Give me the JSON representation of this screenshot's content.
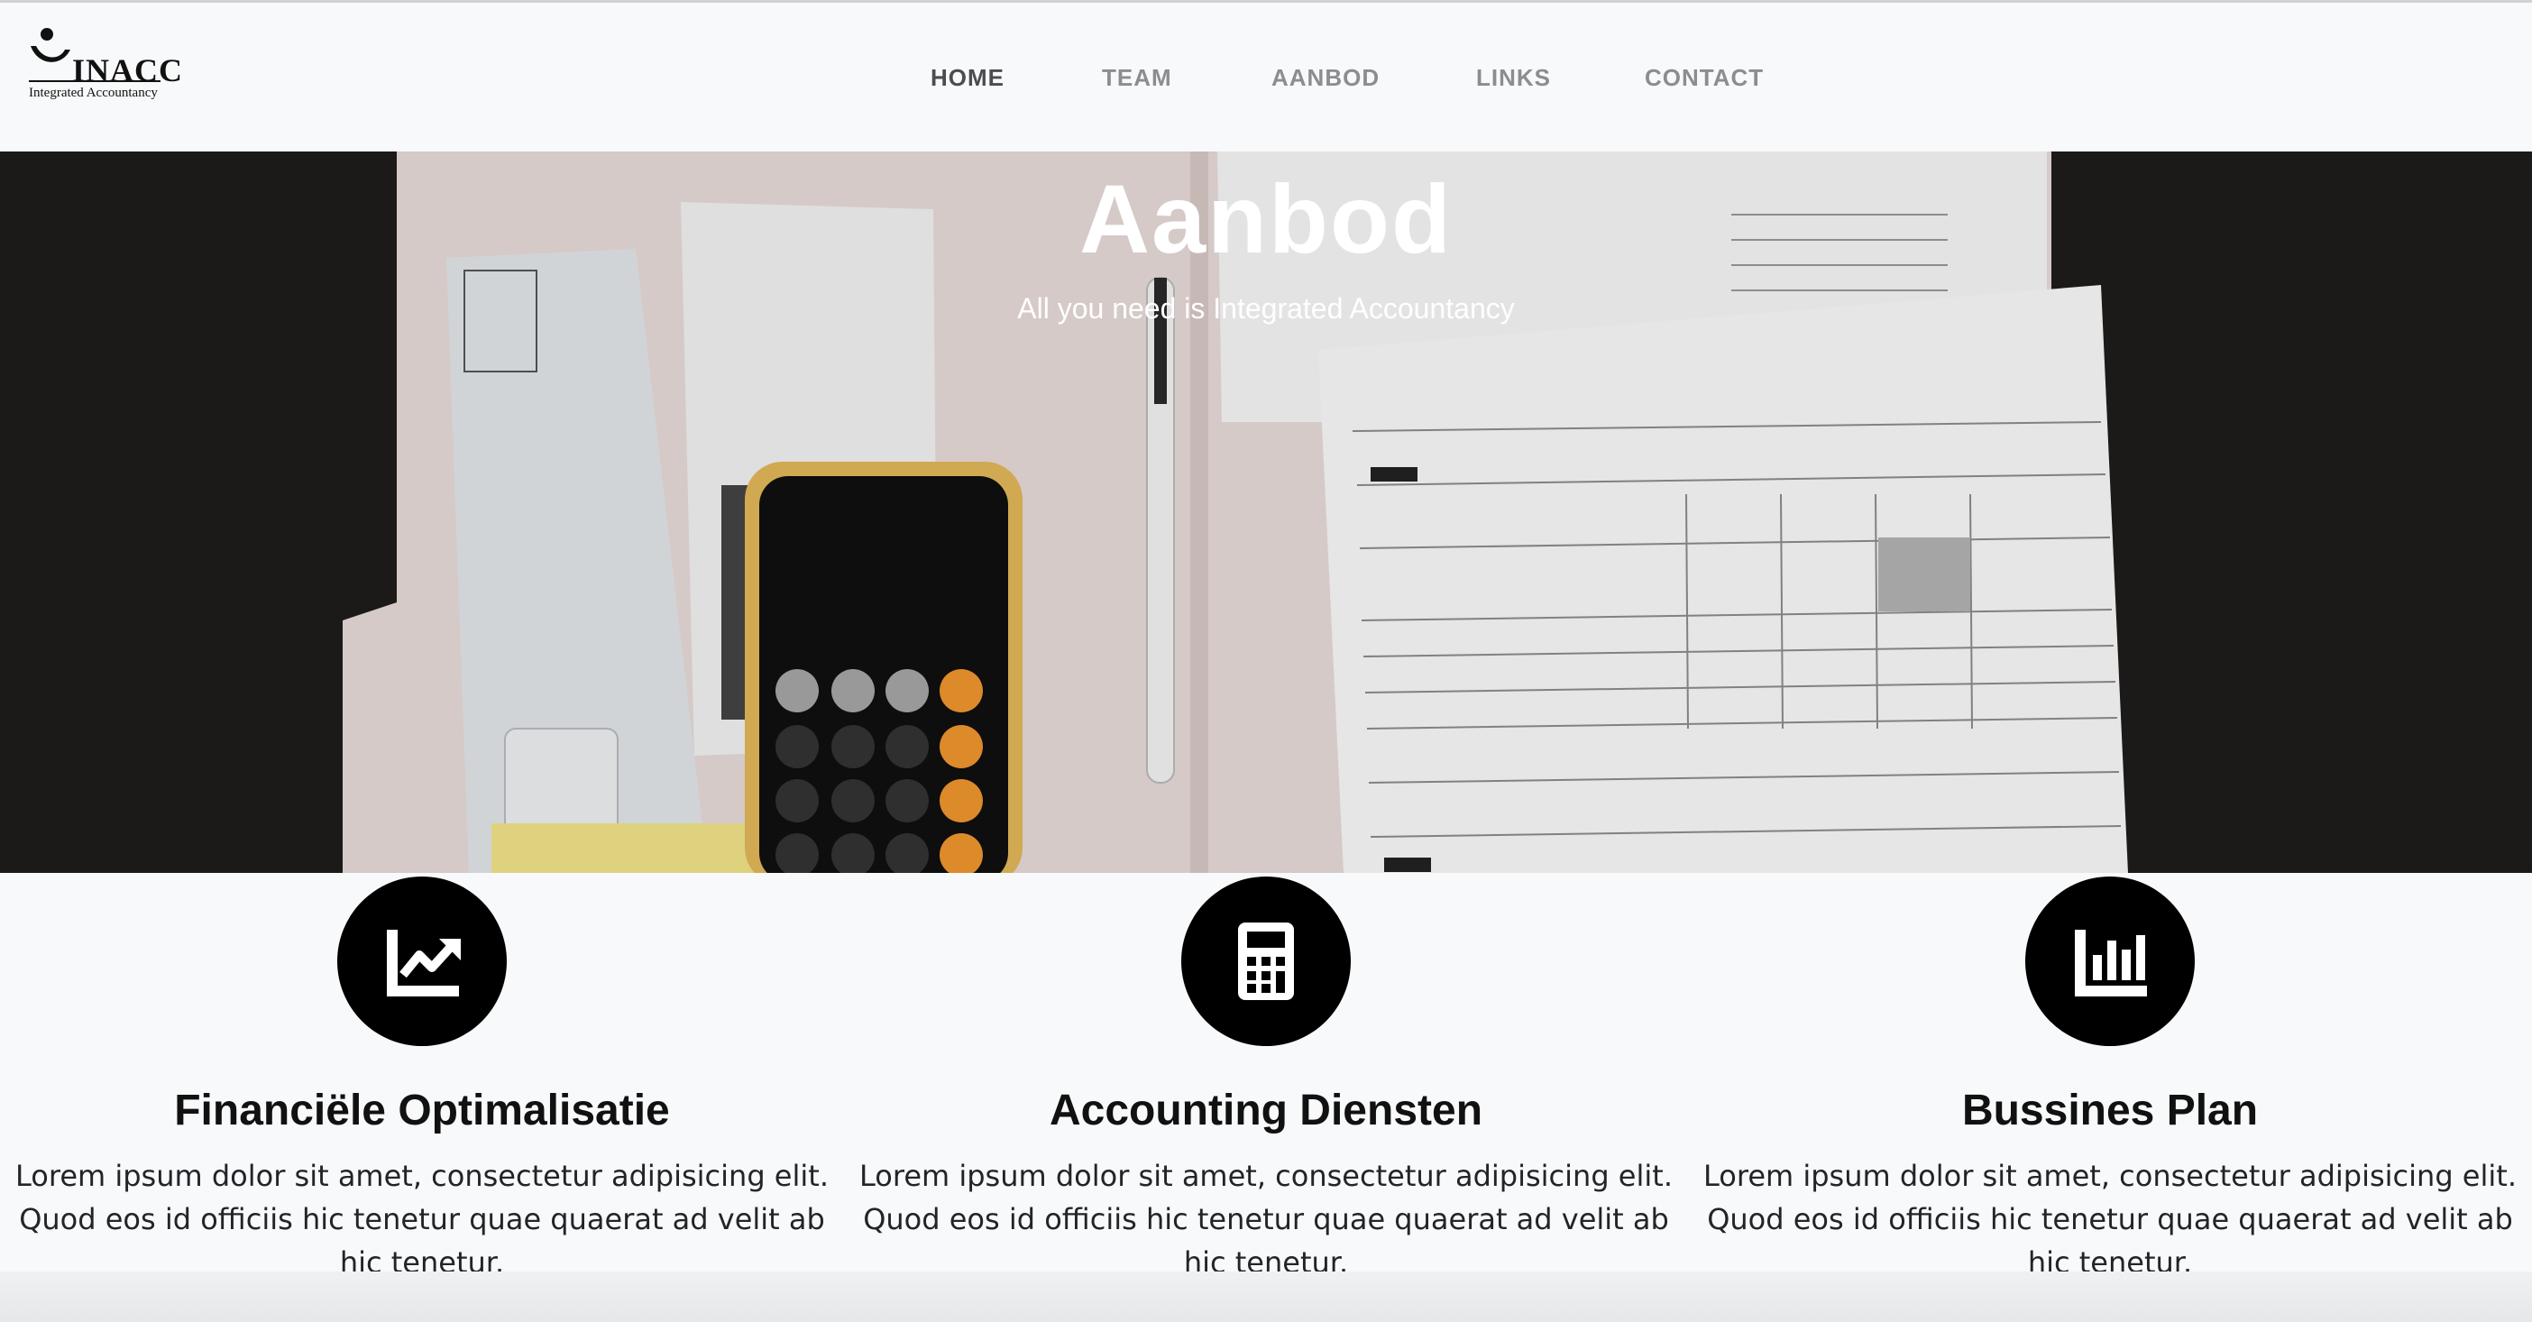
{
  "logo": {
    "brand": "INACC",
    "tagline": "Integrated Accountancy"
  },
  "nav": {
    "items": [
      {
        "label": "HOME",
        "active": true
      },
      {
        "label": "TEAM",
        "active": false
      },
      {
        "label": "AANBOD",
        "active": false
      },
      {
        "label": "LINKS",
        "active": false
      },
      {
        "label": "CONTACT",
        "active": false
      }
    ]
  },
  "hero": {
    "title": "Aanbod",
    "subtitle": "All you need is Integrated Accountancy"
  },
  "services": [
    {
      "icon": "chart-line-icon",
      "title": "Financiële Optimalisatie",
      "text": "Lorem ipsum dolor sit amet, consectetur adipisicing elit. Quod eos id officiis hic tenetur quae quaerat ad velit ab hic tenetur."
    },
    {
      "icon": "calculator-icon",
      "title": "Accounting Diensten",
      "text": "Lorem ipsum dolor sit amet, consectetur adipisicing elit. Quod eos id officiis hic tenetur quae quaerat ad velit ab hic tenetur."
    },
    {
      "icon": "chart-bar-icon",
      "title": "Bussines Plan",
      "text": "Lorem ipsum dolor sit amet, consectetur adipisicing elit. Quod eos id officiis hic tenetur quae quaerat ad velit ab hic tenetur."
    }
  ],
  "colors": {
    "page_bg": "#f8f9fa",
    "nav_text": "#8a8d91",
    "nav_active": "#4a4d51",
    "icon_circle": "#000000",
    "heading": "#111111"
  }
}
